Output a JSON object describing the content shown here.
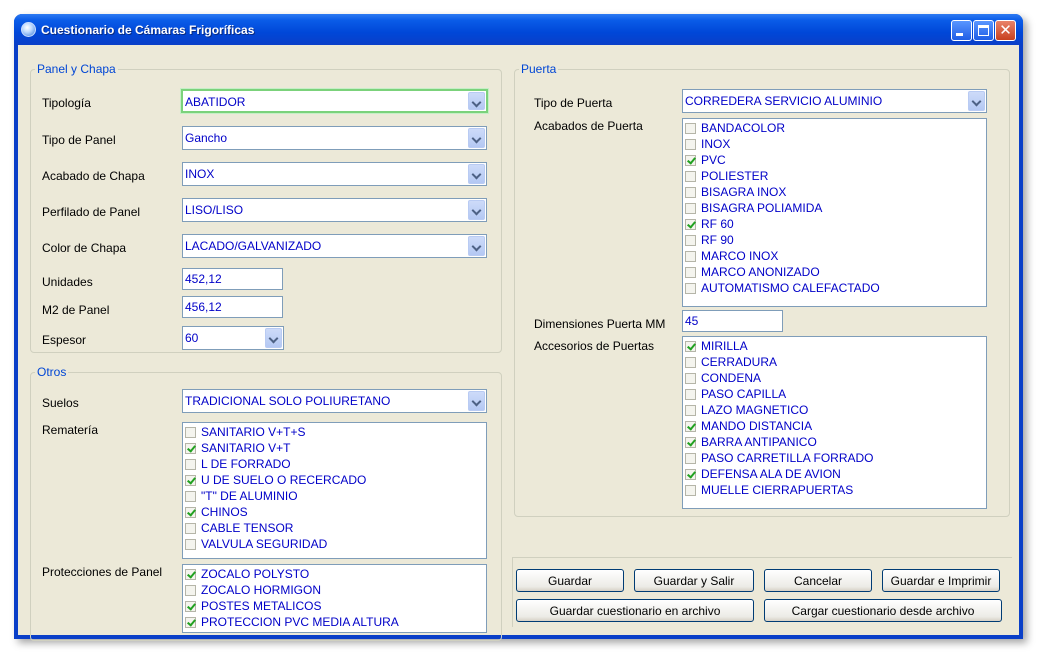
{
  "window": {
    "title": "Cuestionario de Cámaras Frigoríficas",
    "min_icon": "minimize-icon",
    "max_icon": "maximize-icon",
    "close_glyph": "✕"
  },
  "panel": {
    "legend": "Panel y Chapa",
    "tipologia": {
      "label": "Tipología",
      "value": "ABATIDOR"
    },
    "tipo_panel": {
      "label": "Tipo de Panel",
      "value": "Gancho"
    },
    "acabado_chapa": {
      "label": "Acabado de Chapa",
      "value": "INOX"
    },
    "perfilado": {
      "label": "Perfilado de Panel",
      "value": "LISO/LISO"
    },
    "color": {
      "label": "Color de Chapa",
      "value": "LACADO/GALVANIZADO"
    },
    "unidades": {
      "label": "Unidades",
      "value": "452,12"
    },
    "m2": {
      "label": "M2 de Panel",
      "value": "456,12"
    },
    "espesor": {
      "label": "Espesor",
      "value": "60"
    }
  },
  "otros": {
    "legend": "Otros",
    "suelos": {
      "label": "Suelos",
      "value": "TRADICIONAL SOLO POLIURETANO"
    },
    "remateria": {
      "label": "Rematería",
      "items": [
        {
          "label": "SANITARIO V+T+S",
          "checked": false
        },
        {
          "label": "SANITARIO V+T",
          "checked": true
        },
        {
          "label": "L DE FORRADO",
          "checked": false
        },
        {
          "label": "U DE SUELO O RECERCADO",
          "checked": true
        },
        {
          "label": "\"T\" DE ALUMINIO",
          "checked": false
        },
        {
          "label": "CHINOS",
          "checked": true
        },
        {
          "label": "CABLE TENSOR",
          "checked": false
        },
        {
          "label": "VALVULA SEGURIDAD",
          "checked": false
        }
      ]
    },
    "protecciones": {
      "label": "Protecciones de Panel",
      "items": [
        {
          "label": "ZOCALO POLYSTO",
          "checked": true
        },
        {
          "label": "ZOCALO HORMIGON",
          "checked": false
        },
        {
          "label": "POSTES METALICOS",
          "checked": true
        },
        {
          "label": "PROTECCION PVC MEDIA ALTURA",
          "checked": true
        }
      ]
    }
  },
  "puerta": {
    "legend": "Puerta",
    "tipo": {
      "label": "Tipo de Puerta",
      "value": "CORREDERA SERVICIO ALUMINIO"
    },
    "acabados": {
      "label": "Acabados de Puerta",
      "items": [
        {
          "label": "BANDACOLOR",
          "checked": false
        },
        {
          "label": "INOX",
          "checked": false
        },
        {
          "label": "PVC",
          "checked": true
        },
        {
          "label": "POLIESTER",
          "checked": false
        },
        {
          "label": "BISAGRA INOX",
          "checked": false
        },
        {
          "label": "BISAGRA POLIAMIDA",
          "checked": false
        },
        {
          "label": "RF 60",
          "checked": true
        },
        {
          "label": "RF 90",
          "checked": false
        },
        {
          "label": "MARCO INOX",
          "checked": false
        },
        {
          "label": "MARCO ANONIZADO",
          "checked": false
        },
        {
          "label": "AUTOMATISMO CALEFACTADO",
          "checked": false
        }
      ]
    },
    "dimensiones": {
      "label": "Dimensiones Puerta MM",
      "value": "45"
    },
    "accesorios": {
      "label": "Accesorios de Puertas",
      "items": [
        {
          "label": "MIRILLA",
          "checked": true
        },
        {
          "label": "CERRADURA",
          "checked": false
        },
        {
          "label": "CONDENA",
          "checked": false
        },
        {
          "label": "PASO CAPILLA",
          "checked": false
        },
        {
          "label": "LAZO MAGNETICO",
          "checked": false
        },
        {
          "label": "MANDO DISTANCIA",
          "checked": true
        },
        {
          "label": "BARRA ANTIPANICO",
          "checked": true
        },
        {
          "label": "PASO CARRETILLA FORRADO",
          "checked": false
        },
        {
          "label": "DEFENSA ALA DE AVION",
          "checked": true
        },
        {
          "label": "MUELLE CIERRAPUERTAS",
          "checked": false
        }
      ]
    }
  },
  "buttons": {
    "guardar": "Guardar",
    "guardar_salir": "Guardar y Salir",
    "cancelar": "Cancelar",
    "guardar_imprimir": "Guardar e Imprimir",
    "guardar_archivo": "Guardar cuestionario en archivo",
    "cargar_archivo": "Cargar cuestionario desde archivo"
  },
  "colors": {
    "title_bar": "#0a3fc8",
    "value_text": "#0000c8",
    "legend_text": "#0046d5",
    "panel_bg": "#ece9d8",
    "check_mark": "#21a121"
  }
}
